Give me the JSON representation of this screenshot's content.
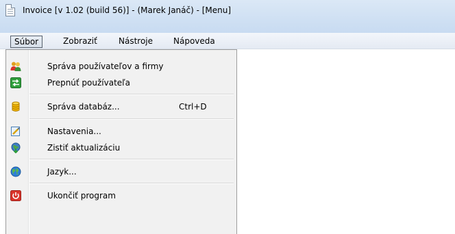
{
  "window": {
    "title": "Invoice [v 1.02 (build 56)]  -  (Marek Janáč) - [Menu]"
  },
  "menubar": {
    "items": [
      {
        "label": "Súbor",
        "active": true
      },
      {
        "label": "Zobraziť",
        "active": false
      },
      {
        "label": "Nástroje",
        "active": false
      },
      {
        "label": "Nápoveda",
        "active": false
      }
    ]
  },
  "dropdown": {
    "items": [
      {
        "label": "Správa používateľov a firmy",
        "icon": "users-icon",
        "shortcut": ""
      },
      {
        "label": "Prepnúť používateľa",
        "icon": "switch-user-icon",
        "shortcut": ""
      },
      {
        "label": "Správa databáz...",
        "icon": "database-icon",
        "shortcut": "Ctrl+D"
      },
      {
        "label": "Nastavenia...",
        "icon": "settings-icon",
        "shortcut": ""
      },
      {
        "label": "Zistiť aktualizáciu",
        "icon": "update-icon",
        "shortcut": ""
      },
      {
        "label": "Jazyk...",
        "icon": "globe-icon",
        "shortcut": ""
      },
      {
        "label": "Ukončiť program",
        "icon": "power-icon",
        "shortcut": ""
      }
    ]
  },
  "colors": {
    "titlebar": "#cfe0f3",
    "menu_background": "#f1f1f1",
    "exit_red": "#d9342b",
    "switch_green": "#2f9e3b",
    "database_yellow": "#f0b400",
    "globe_blue": "#2f7fd6"
  }
}
